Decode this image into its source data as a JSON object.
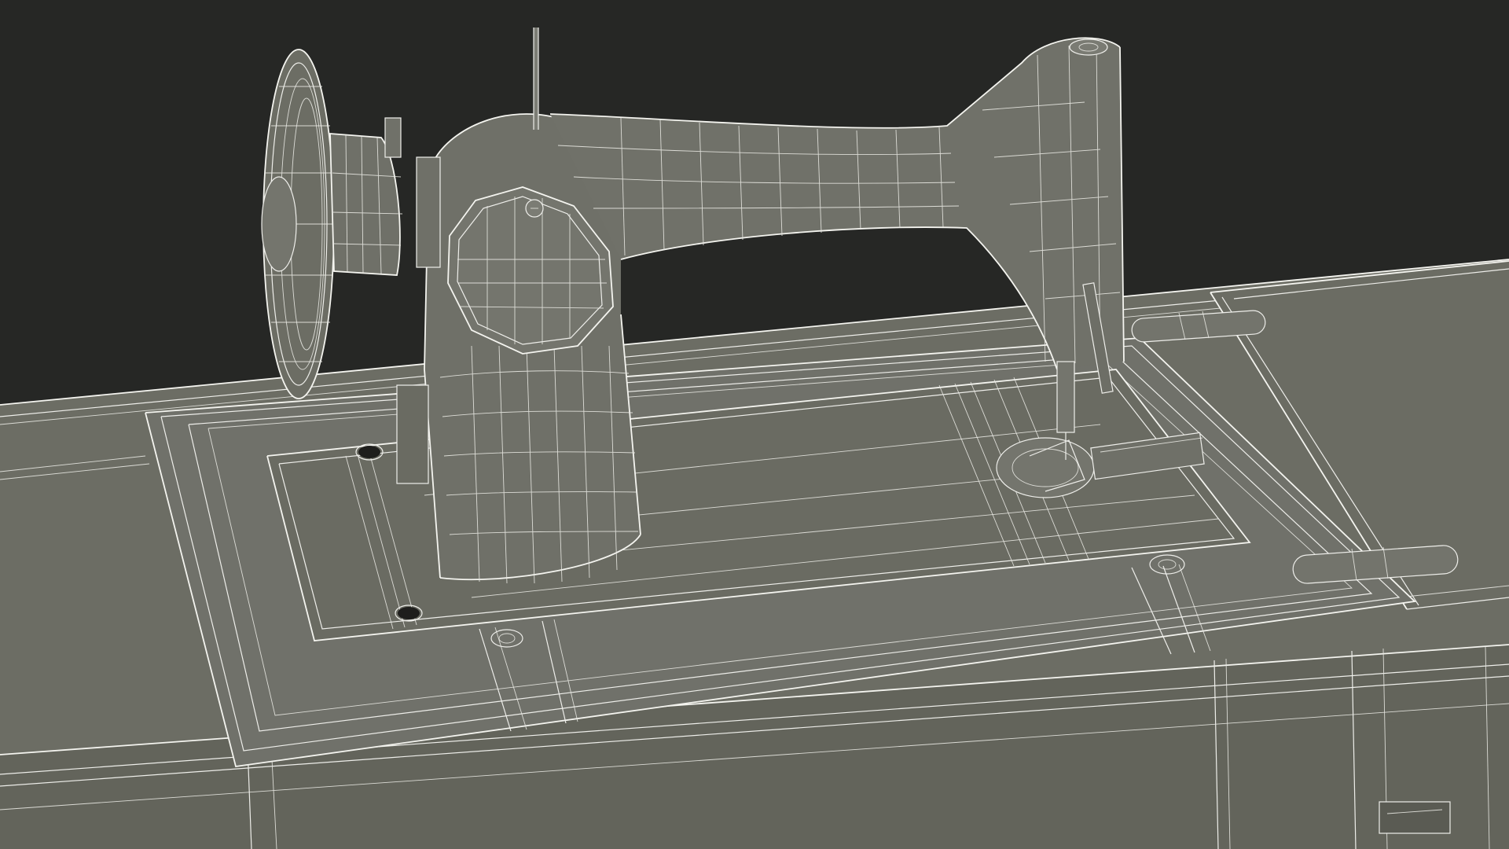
{
  "viewport": {
    "background_color": "#262725",
    "model_color": "#6e6f66",
    "wire_color": "#eeeeea"
  },
  "objects": [
    {
      "name": "sewing-machine-head"
    },
    {
      "name": "handwheel"
    },
    {
      "name": "spool-pin"
    },
    {
      "name": "needle-bar"
    },
    {
      "name": "presser-foot"
    },
    {
      "name": "bed-plate"
    },
    {
      "name": "hinges"
    },
    {
      "name": "table-top"
    },
    {
      "name": "fold-leaf"
    },
    {
      "name": "drawer"
    }
  ]
}
